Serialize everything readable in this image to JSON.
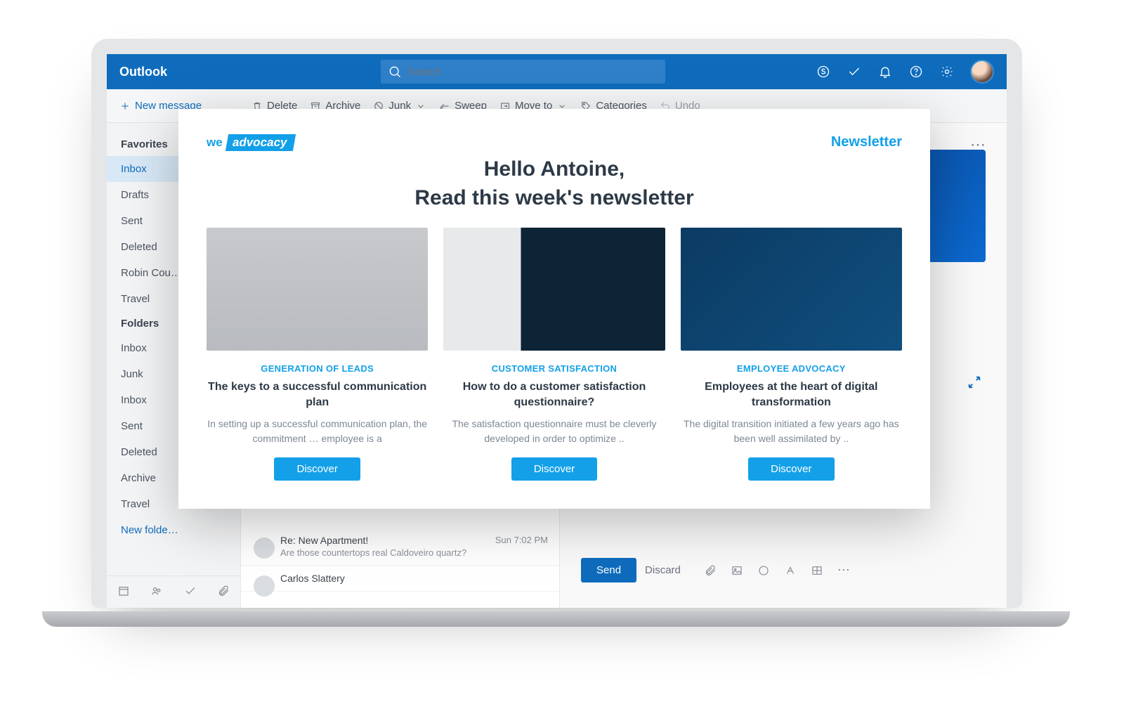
{
  "header": {
    "brand": "Outlook",
    "search_placeholder": "Search"
  },
  "toolbar": {
    "new": "New message",
    "delete": "Delete",
    "archive": "Archive",
    "junk": "Junk",
    "sweep": "Sweep",
    "moveto": "Move to",
    "categories": "Categories",
    "undo": "Undo"
  },
  "sidebar": {
    "favorites_label": "Favorites",
    "folders_label": "Folders",
    "favorites": [
      {
        "label": "Inbox",
        "active": true
      },
      {
        "label": "Drafts"
      },
      {
        "label": "Sent"
      },
      {
        "label": "Deleted"
      },
      {
        "label": "Robin Cou…"
      },
      {
        "label": "Travel"
      }
    ],
    "folders": [
      {
        "label": "Inbox"
      },
      {
        "label": "Junk"
      },
      {
        "label": "Inbox"
      },
      {
        "label": "Sent"
      },
      {
        "label": "Deleted"
      },
      {
        "label": "Archive"
      },
      {
        "label": "Travel"
      },
      {
        "label": "New folde…",
        "muted": true
      }
    ]
  },
  "mail": {
    "item1": {
      "subject": "Re: New Apartment!",
      "time": "Sun 7:02 PM",
      "preview": "Are those countertops real Caldoveiro quartz?"
    },
    "item2": {
      "sender": "Carlos Slattery"
    }
  },
  "compose": {
    "send": "Send",
    "discard": "Discard"
  },
  "newsletter": {
    "logo_we": "we",
    "logo_adv": "advocacy",
    "badge": "Newsletter",
    "hello": "Hello Antoine,",
    "subhead": "Read this week's newsletter",
    "discover": "Discover",
    "cards": [
      {
        "category": "GENERATION OF LEADS",
        "title": "The keys to a successful communication plan",
        "desc": "In setting up a successful communication plan, the commitment … employee is a"
      },
      {
        "category": "CUSTOMER SATISFACTION",
        "title": "How to do a customer satisfaction questionnaire?",
        "desc": "The satisfaction questionnaire must be cleverly developed in order to optimize .."
      },
      {
        "category": "EMPLOYEE ADVOCACY",
        "title": "Employees at the heart of digital transformation",
        "desc": "The digital transition initiated a few years ago has been well assimilated by .."
      }
    ]
  }
}
